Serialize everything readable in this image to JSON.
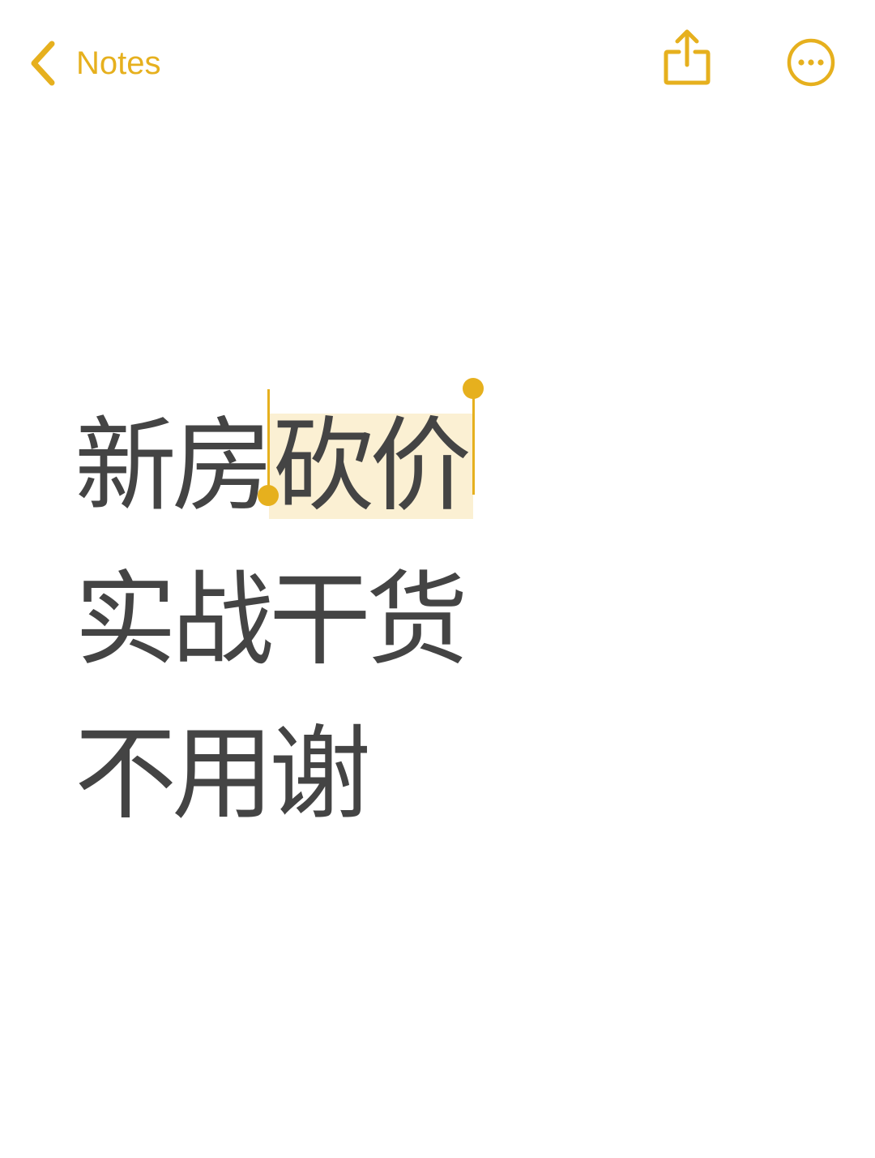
{
  "navbar": {
    "back_label": "Notes",
    "back_icon": "chevron-left-icon",
    "share_icon": "share-icon",
    "more_icon": "ellipsis-circle-icon"
  },
  "note": {
    "line1_prefix": "新房",
    "line1_selected": "砍价",
    "line2": "实战干货",
    "line3": "不用谢"
  },
  "colors": {
    "accent": "#E6B01E",
    "selection": "#FBF0D3",
    "text": "#444444",
    "background": "#FFFFFF"
  }
}
